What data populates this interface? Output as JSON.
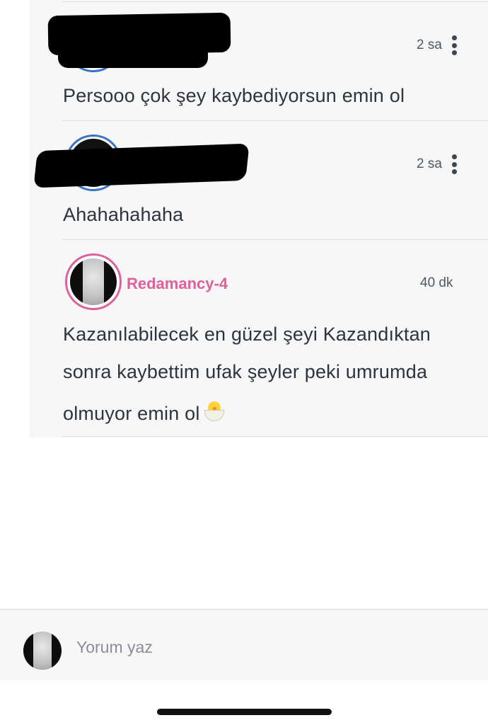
{
  "comments": [
    {
      "username": "",
      "time": "2 sa",
      "text": "Persooo çok şey kaybediyorsun emin ol",
      "redacted": true
    },
    {
      "username": "",
      "time": "2 sa",
      "text": "Ahahahahaha",
      "redacted": true
    },
    {
      "username": "Redamancy-4",
      "time": "40 dk",
      "text_lines": [
        "Kazanılabilecek en güzel şeyi Kazandıktan",
        "sonra kaybettim ufak şeyler peki umrumda",
        "olmuyor emin ol"
      ],
      "emoji": "hatching-chick-emoji"
    }
  ],
  "composer": {
    "placeholder": "Yorum yaz"
  },
  "colors": {
    "accent_pink": "#e0609a",
    "ring_blue": "#3a72c9",
    "thread_bg": "#f7f7f7",
    "text": "#2c3440"
  }
}
